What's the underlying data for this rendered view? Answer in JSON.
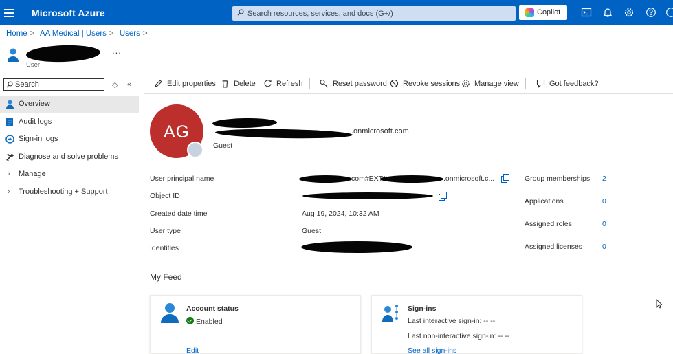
{
  "topbar": {
    "brand": "Microsoft Azure",
    "search_placeholder": "Search resources, services, and docs (G+/)",
    "copilot_label": "Copilot"
  },
  "breadcrumb": [
    "Home",
    "AA Medical | Users",
    "Users"
  ],
  "header": {
    "role": "User",
    "more": "..."
  },
  "nav": {
    "search_placeholder": "Search",
    "items": [
      {
        "label": "Overview",
        "icon": "person-icon",
        "selected": true
      },
      {
        "label": "Audit logs",
        "icon": "audit-log-icon"
      },
      {
        "label": "Sign-in logs",
        "icon": "sign-in-log-icon"
      },
      {
        "label": "Diagnose and solve problems",
        "icon": "wrench-icon"
      },
      {
        "label": "Manage",
        "icon": "chevron-right-icon"
      },
      {
        "label": "Troubleshooting + Support",
        "icon": "chevron-right-icon"
      }
    ]
  },
  "toolbar": {
    "edit": "Edit properties",
    "delete": "Delete",
    "refresh": "Refresh",
    "reset": "Reset password",
    "revoke": "Revoke sessions",
    "manage": "Manage view",
    "feedback": "Got feedback?"
  },
  "profile": {
    "initials": "AG",
    "email_suffix": ".onmicrosoft.com",
    "type": "Guest"
  },
  "properties": [
    {
      "label": "User principal name",
      "value": ".onmicrosoft.c...",
      "value_prefix": "com#EXT#"
    },
    {
      "label": "Object ID",
      "value": ""
    },
    {
      "label": "Created date time",
      "value": "Aug 19, 2024, 10:32 AM"
    },
    {
      "label": "User type",
      "value": "Guest"
    },
    {
      "label": "Identities",
      "value": ""
    }
  ],
  "stats": [
    {
      "label": "Group memberships",
      "value": "2"
    },
    {
      "label": "Applications",
      "value": "0"
    },
    {
      "label": "Assigned roles",
      "value": "0"
    },
    {
      "label": "Assigned licenses",
      "value": "0"
    }
  ],
  "feed": {
    "title": "My Feed",
    "account": {
      "title": "Account status",
      "status": "Enabled",
      "link": "Edit"
    },
    "signins": {
      "title": "Sign-ins",
      "last_interactive": "Last interactive sign-in: -- --",
      "last_noninteractive": "Last non-interactive sign-in: -- --",
      "link": "See all sign-ins"
    }
  },
  "colors": {
    "topbar": "#0063c4",
    "link": "#0063c4",
    "avatar": "#bc2f2c",
    "enabled": "#107c10"
  }
}
